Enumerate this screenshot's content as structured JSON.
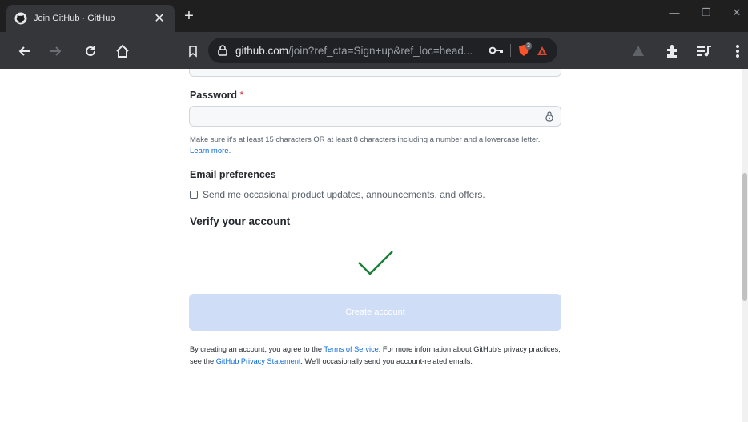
{
  "browser": {
    "tab_title": "Join GitHub · GitHub",
    "tab_close": "✕",
    "new_tab": "+",
    "url_host": "github.com",
    "url_rest": "/join?ref_cta=Sign+up&ref_loc=head...",
    "icons": [
      "github-icon",
      "back-icon",
      "forward-icon",
      "reload-icon",
      "home-icon",
      "bookmark-icon",
      "lock-icon",
      "key-icon",
      "brave-shield-icon",
      "brave-rewards-icon",
      "extensions-icon",
      "reading-list-icon",
      "menu-icon"
    ],
    "shield_badge": "3",
    "window_minimize": "—",
    "window_restore": "❐",
    "window_close": "✕"
  },
  "form": {
    "password_label": "Password",
    "required_marker": "*",
    "password_hint": "Make sure it's at least 15 characters OR at least 8 characters including a number and a lowercase letter.",
    "learn_more": "Learn more.",
    "email_prefs_label": "Email preferences",
    "email_prefs_checkbox": "Send me occasional product updates, announcements, and offers.",
    "verify_title": "Verify your account",
    "create_button": "Create account",
    "legal_1": "By creating an account, you agree to the ",
    "tos_link": "Terms of Service",
    "legal_2": ". For more information about GitHub's privacy practices, see the ",
    "privacy_link": "GitHub Privacy Statement",
    "legal_3": ". We'll occasionally send you account-related emails."
  },
  "colors": {
    "accent_link": "#0969da",
    "verify_check": "#1a7f37",
    "button_disabled": "#cfddf7",
    "required": "#cf222e"
  }
}
